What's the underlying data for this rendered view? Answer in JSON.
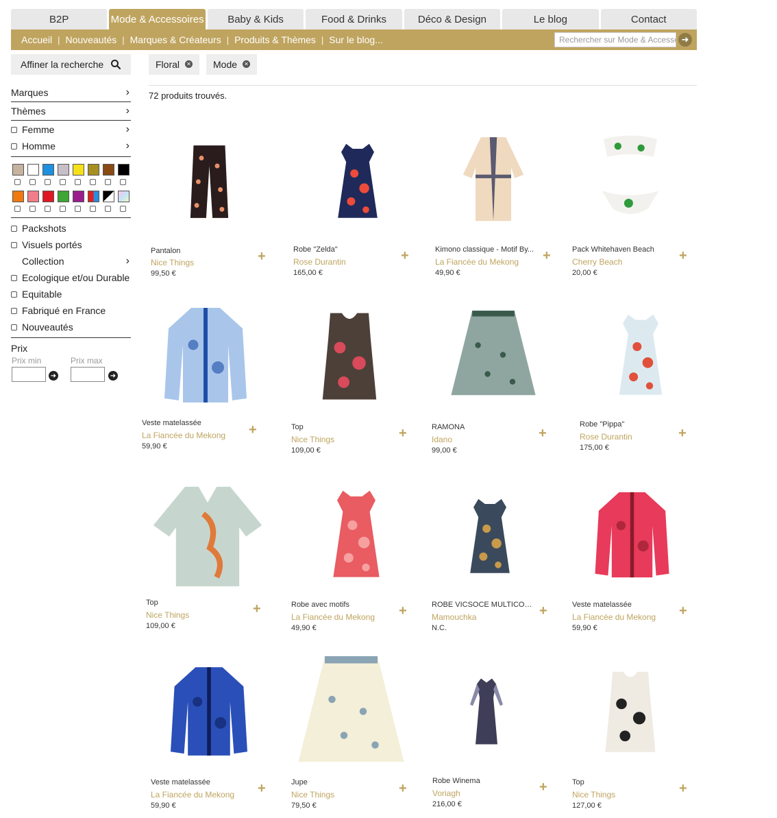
{
  "top_tabs": [
    "B2P",
    "Mode & Accessoires",
    "Baby & Kids",
    "Food & Drinks",
    "Déco & Design",
    "Le blog",
    "Contact"
  ],
  "subnav": {
    "items": [
      "Accueil",
      "Nouveautés",
      "Marques & Créateurs",
      "Produits & Thèmes",
      "Sur le blog..."
    ],
    "search_placeholder": "Rechercher sur Mode & Accessoires"
  },
  "sidebar": {
    "refine_label": "Affiner la recherche",
    "marques": "Marques",
    "themes": "Thèmes",
    "femme": "Femme",
    "homme": "Homme",
    "packshots": "Packshots",
    "visuels": "Visuels portés",
    "collection": "Collection",
    "ecologique": "Ecologique et/ou Durable",
    "equitable": "Equitable",
    "fabrique": "Fabriqué en France",
    "nouveautes": "Nouveautés",
    "prix": "Prix",
    "prix_min": "Prix min",
    "prix_max": "Prix max"
  },
  "colors": {
    "accent": "#bfa45f",
    "swatches_row1": [
      "#c5b29f",
      "#ffffff",
      "#1e90e0",
      "#c7bfc7",
      "#f5e11a",
      "#a88f22",
      "#8a4a14",
      "#000000"
    ],
    "swatches_row2": [
      "#f07a10",
      "#f07e8a",
      "#e01824",
      "#3fa535",
      "#9b1c8c",
      "multi",
      "bw",
      "pastel"
    ]
  },
  "filters": [
    "Floral",
    "Mode"
  ],
  "count_text": "72 produits trouvés.",
  "products": [
    {
      "name": "Pantalon",
      "brand": "Nice Things",
      "price": "99,50 €"
    },
    {
      "name": "Robe \"Zelda\"",
      "brand": "Rose Durantin",
      "price": "165,00 €"
    },
    {
      "name": "Kimono classique - Motif By...",
      "brand": "La Fiancée du Mekong",
      "price": "49,90 €"
    },
    {
      "name": "Pack Whitehaven Beach",
      "brand": "Cherry Beach",
      "price": "20,00 €"
    },
    {
      "name": "Veste matelassée",
      "brand": "La Fiancée du Mekong",
      "price": "59,90 €"
    },
    {
      "name": "Top",
      "brand": "Nice Things",
      "price": "109,00 €"
    },
    {
      "name": "RAMONA",
      "brand": "Idano",
      "price": "99,00 €"
    },
    {
      "name": "Robe \"Pippa\"",
      "brand": "Rose Durantin",
      "price": "175,00 €"
    },
    {
      "name": "Top",
      "brand": "Nice Things",
      "price": "109,00 €"
    },
    {
      "name": "Robe avec motifs",
      "brand": "La Fiancée du Mekong",
      "price": "49,90 €"
    },
    {
      "name": "ROBE VICSOCE MULTICOLO...",
      "brand": "Mamouchka",
      "price": "N.C."
    },
    {
      "name": "Veste matelassée",
      "brand": "La Fiancée du Mekong",
      "price": "59,90 €"
    },
    {
      "name": "Veste matelassée",
      "brand": "La Fiancée du Mekong",
      "price": "59,90 €"
    },
    {
      "name": "Jupe",
      "brand": "Nice Things",
      "price": "79,50 €"
    },
    {
      "name": "Robe Winema",
      "brand": "Voriagh",
      "price": "216,00 €"
    },
    {
      "name": "Top",
      "brand": "Nice Things",
      "price": "127,00 €"
    }
  ]
}
